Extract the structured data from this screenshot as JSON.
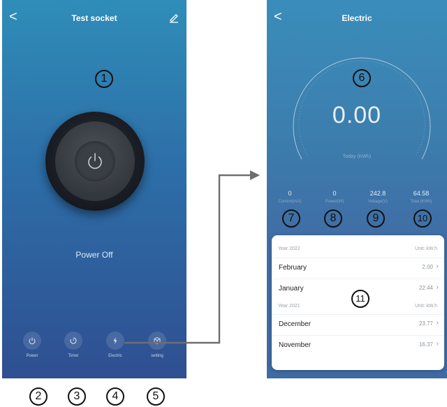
{
  "left_screen": {
    "title": "Test socket",
    "back_glyph": "<",
    "status": "Power Off",
    "nav": [
      {
        "label": "Power",
        "icon": "power-icon"
      },
      {
        "label": "Timer",
        "icon": "timer-icon"
      },
      {
        "label": "Electric",
        "icon": "lightning-icon"
      },
      {
        "label": "setting",
        "icon": "cube-icon"
      }
    ]
  },
  "right_screen": {
    "title": "Electric",
    "back_glyph": "<",
    "today_value": "0.00",
    "today_label": "Today (KWh)",
    "stats": [
      {
        "value": "0",
        "label": "Current(mA)"
      },
      {
        "value": "0",
        "label": "Power(W)"
      },
      {
        "value": "242.8",
        "label": "Voltage(V)"
      },
      {
        "value": "64.58",
        "label": "Total (KWh)"
      }
    ],
    "history": [
      {
        "year": "Year 2022",
        "unit": "Unit: kW.h",
        "months": [
          {
            "name": "February",
            "value": "2.00"
          },
          {
            "name": "January",
            "value": "22.44"
          }
        ]
      },
      {
        "year": "Year 2021",
        "unit": "Unit: kW.h",
        "months": [
          {
            "name": "December",
            "value": "23.77"
          },
          {
            "name": "November",
            "value": "16.37"
          }
        ]
      }
    ]
  },
  "callouts": [
    "1",
    "2",
    "3",
    "4",
    "5",
    "6",
    "7",
    "8",
    "9",
    "10",
    "11"
  ],
  "colors": {
    "arrow": "#6e6e6e"
  }
}
